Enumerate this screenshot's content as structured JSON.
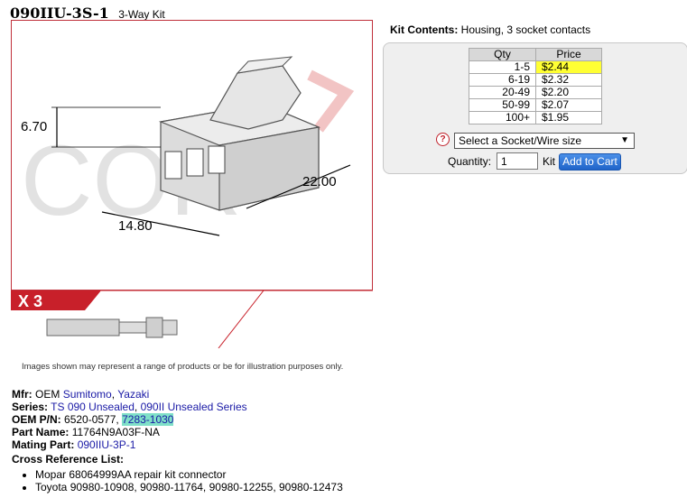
{
  "header": {
    "part_number": "090IIU-3S-1",
    "subtitle": "3-Way Kit"
  },
  "image": {
    "dim_height": "6.70",
    "dim_length": "22.00",
    "dim_width": "14.80",
    "watermark": "COR",
    "quantity_badge": "X 3"
  },
  "disclaimer": "Images shown may represent a range of products or be for illustration purposes only.",
  "kit": {
    "contents_label": "Kit Contents:",
    "contents_value": "Housing, 3 socket contacts"
  },
  "pricing": {
    "headers": {
      "qty": "Qty",
      "price": "Price"
    },
    "rows": [
      {
        "qty": "1-5",
        "price": "$2.44"
      },
      {
        "qty": "6-19",
        "price": "$2.32"
      },
      {
        "qty": "20-49",
        "price": "$2.20"
      },
      {
        "qty": "50-99",
        "price": "$2.07"
      },
      {
        "qty": "100+",
        "price": "$1.95"
      }
    ]
  },
  "order": {
    "help": "?",
    "socket_select": "Select a Socket/Wire size",
    "quantity_label": "Quantity:",
    "quantity_value": "1",
    "unit_label": "Kit",
    "add_button": "Add to Cart"
  },
  "details": {
    "mfr_label": "Mfr:",
    "mfr_prefix": "OEM",
    "mfr_links": [
      "Sumitomo",
      "Yazaki"
    ],
    "series_label": "Series:",
    "series_links": [
      "TS 090 Unsealed",
      "090II Unsealed Series"
    ],
    "oem_pn_label": "OEM P/N:",
    "oem_pn_text": "6520-0577,",
    "oem_pn_link": "7283-1030",
    "part_name_label": "Part Name:",
    "part_name_value": "11764N9A03F-NA",
    "mating_label": "Mating Part:",
    "mating_link": "090IIU-3P-1",
    "xref_title": "Cross Reference List:",
    "xref_items": [
      "Mopar 68064999AA repair kit connector",
      "Toyota 90980-10908, 90980-11764, 90980-12255, 90980-12473"
    ]
  }
}
